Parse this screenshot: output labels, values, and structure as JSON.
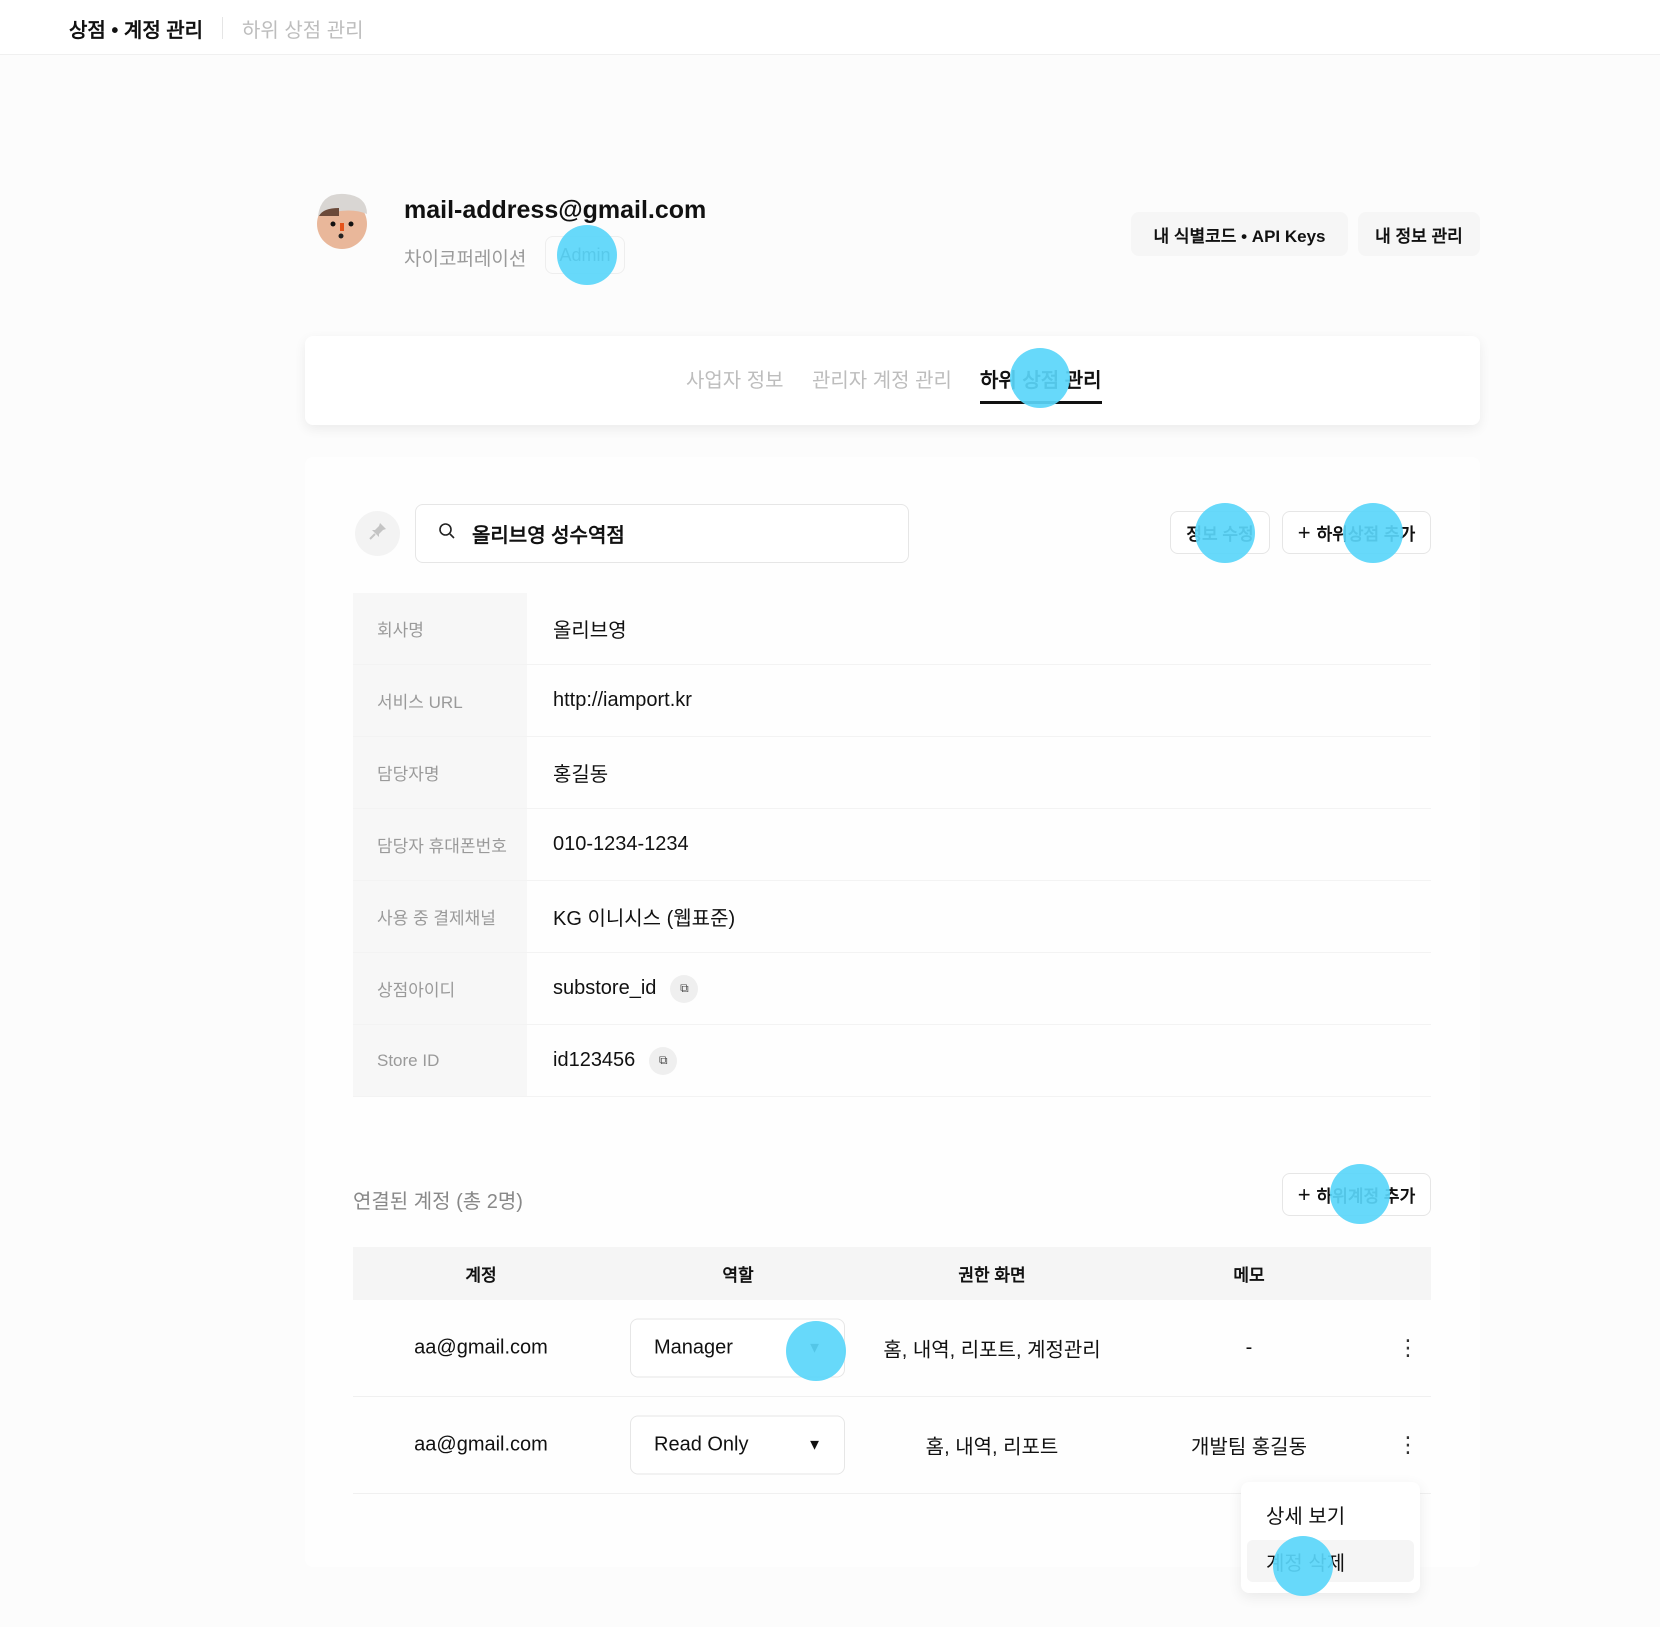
{
  "header": {
    "breadcrumb": [
      "상점 • 계정 관리",
      "하위 상점 관리"
    ]
  },
  "profile": {
    "email": "mail-address@gmail.com",
    "company": "차이코퍼레이션",
    "role_badge": "Admin"
  },
  "top_buttons": {
    "api_keys": "내 식별코드 • API Keys",
    "my_info": "내 정보 관리"
  },
  "tabs": [
    {
      "label": "사업자 정보",
      "active": false
    },
    {
      "label": "관리자 계정 관리",
      "active": false
    },
    {
      "label": "하위 상점 관리",
      "active": true
    }
  ],
  "store": {
    "search_value": "올리브영 성수역점",
    "edit_label": "정보 수정",
    "add_store_label": "하위상점 추가",
    "fields": [
      {
        "label": "회사명",
        "value": "올리브영"
      },
      {
        "label": "서비스 URL",
        "value": "http://iamport.kr"
      },
      {
        "label": "담당자명",
        "value": "홍길동"
      },
      {
        "label": "담당자 휴대폰번호",
        "value": "010-1234-1234"
      },
      {
        "label": "사용 중 결제채널",
        "value": "KG 이니시스 (웹표준)"
      },
      {
        "label": "상점아이디",
        "value": "substore_id",
        "copy": true
      },
      {
        "label": "Store ID",
        "value": "id123456",
        "copy": true
      }
    ]
  },
  "accounts": {
    "title": "연결된 계정 (총 2명)",
    "add_label": "하위계정 추가",
    "columns": [
      "계정",
      "역할",
      "권한 화면",
      "메모"
    ],
    "rows": [
      {
        "account": "aa@gmail.com",
        "role": "Manager",
        "screens": "홈, 내역, 리포트, 계정관리",
        "memo": "-"
      },
      {
        "account": "aa@gmail.com",
        "role": "Read Only",
        "screens": "홈, 내역, 리포트",
        "memo": "개발팀 홍길동"
      }
    ]
  },
  "row_menu": {
    "items": [
      "상세 보기",
      "계정 삭제"
    ],
    "highlighted": "계정 삭제"
  },
  "colors": {
    "touch_indicator": "#5ad6fa",
    "active_tab": "#111111",
    "muted_text": "#bdbdbd"
  }
}
